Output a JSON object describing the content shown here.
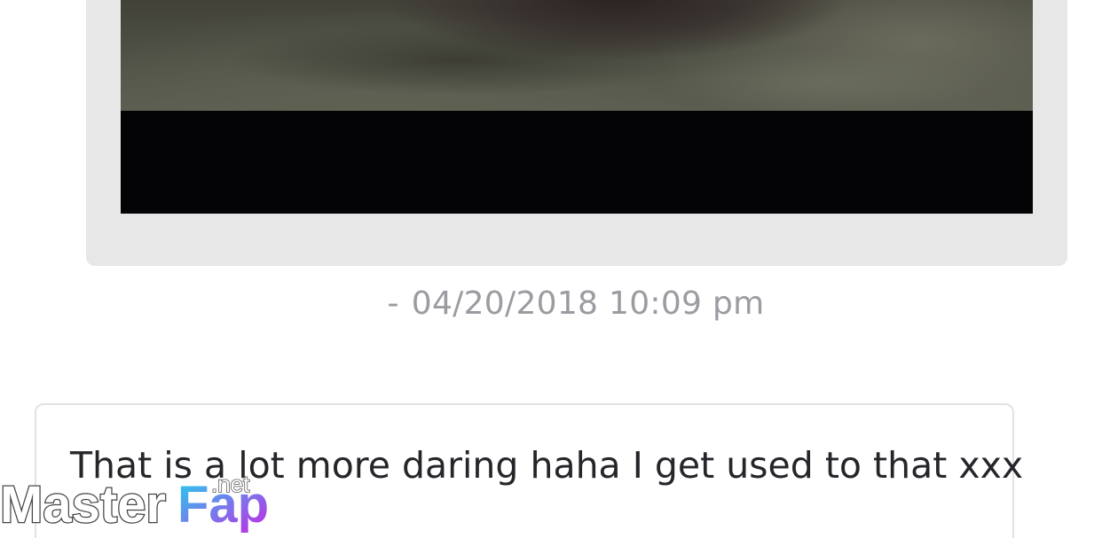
{
  "messages": [
    {
      "type": "media",
      "direction": "sent",
      "timestamp": "04/20/2018 10:09 pm",
      "timestamp_prefix": "-"
    },
    {
      "type": "text",
      "direction": "received",
      "text": "That is a lot more daring haha I get used to that xxx"
    }
  ],
  "watermark": {
    "brand_part_1": "Master",
    "brand_part_2": "Fap",
    "suffix": ".net"
  },
  "colors": {
    "sent_bubble": "#e8e7e8",
    "received_bubble_border": "#e2e1e5",
    "timestamp": "#9b9ba1",
    "message_text": "#26252a",
    "logo_gradient_start": "#21d3f0",
    "logo_gradient_end": "#c725e6"
  }
}
